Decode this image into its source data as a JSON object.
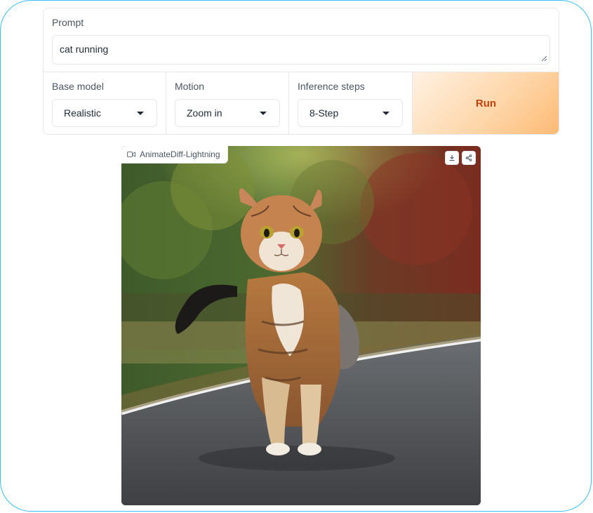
{
  "prompt": {
    "label": "Prompt",
    "value": "cat running"
  },
  "controls": [
    {
      "label": "Base model",
      "value": "Realistic"
    },
    {
      "label": "Motion",
      "value": "Zoom in"
    },
    {
      "label": "Inference steps",
      "value": "8-Step"
    }
  ],
  "run_button": {
    "label": "Run"
  },
  "output": {
    "label": "AnimateDiff-Lightning",
    "tools": [
      "download-icon",
      "share-icon"
    ]
  },
  "colors": {
    "frame_border": "#38bdf8",
    "run_text": "#c2410c",
    "run_gradient_end": "#fdba74"
  }
}
